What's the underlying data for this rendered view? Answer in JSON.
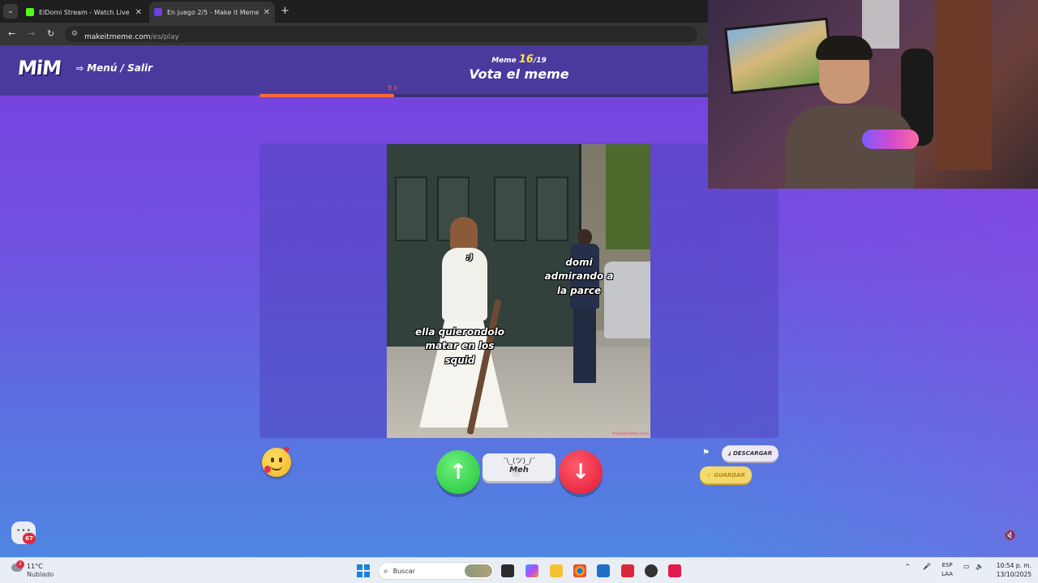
{
  "browser": {
    "tabs": [
      {
        "title": "ElDomi Stream - Watch Live on",
        "favicon_color": "#53fc18"
      },
      {
        "title": "En juego 2/5 - Make it Meme",
        "favicon_color": "#6f3fe0"
      }
    ],
    "new_tab_symbol": "+",
    "url_domain": "makeitmeme.com",
    "url_path": "/es/play"
  },
  "game": {
    "logo": "MiM",
    "menu_label": "Menú / Salir",
    "meme_label": "Meme",
    "meme_current": "16",
    "meme_total": "/19",
    "title": "Vota el meme",
    "timer": "5 s",
    "timer_progress": 0.26,
    "captions": {
      "smiley": ":)",
      "groom": "domi\nadmirando a\nla parce",
      "bride": "ella quierondolo\nmatar en los\nsquid"
    },
    "watermark": "makeitmeme.com",
    "vote": {
      "meh_shrug": "¯\\_(ツ)_/¯",
      "meh_label": "Meh"
    },
    "download_label": "DESCARGAR",
    "save_label": "GUARDAR",
    "chat_badge": "67",
    "colors": {
      "accent": "#ffe23a",
      "up": "#1ec23a",
      "down": "#e01830",
      "timer": "#ff6a3a"
    }
  },
  "taskbar": {
    "weather_temp": "11°C",
    "weather_desc": "Nublado",
    "weather_badge": "2",
    "search_placeholder": "Buscar",
    "lang_1": "ESP",
    "lang_2": "LAA",
    "time": "10:54 p. m.",
    "date": "13/10/2025"
  }
}
